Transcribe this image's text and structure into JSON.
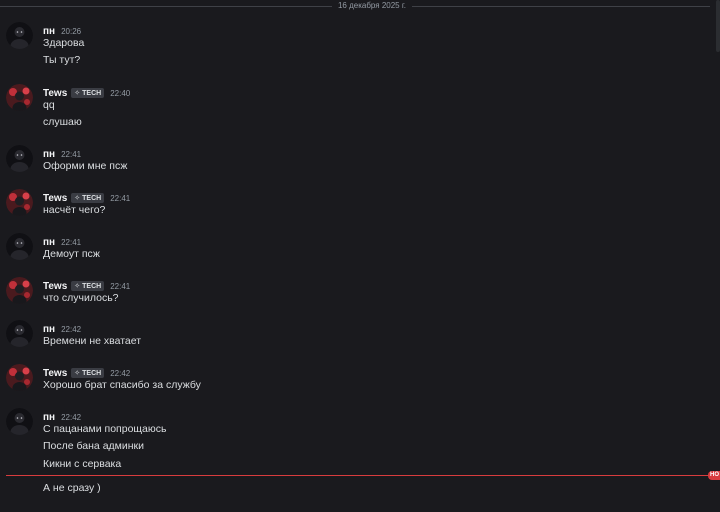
{
  "date_divider": "16 декабря 2025 г.",
  "new_badge": "НО",
  "colors": {
    "background": "#1a1a1e",
    "new_messages_line": "#d83c3e",
    "username": "#f2f3f5",
    "timestamp": "#949ba4"
  },
  "tag": {
    "icon": "diamond-sparkle-icon",
    "label": "TECH"
  },
  "messages": [
    {
      "author": "пн",
      "time": "20:26",
      "lines": [
        "Здарова",
        "Ты тут?"
      ]
    },
    {
      "author": "Tews",
      "time": "22:40",
      "lines": [
        "qq",
        "слушаю"
      ]
    },
    {
      "author": "пн",
      "time": "22:41",
      "lines": [
        "Оформи мне псж"
      ]
    },
    {
      "author": "Tews",
      "time": "22:41",
      "lines": [
        "насчёт чего?"
      ]
    },
    {
      "author": "пн",
      "time": "22:41",
      "lines": [
        "Демоут псж"
      ]
    },
    {
      "author": "Tews",
      "time": "22:41",
      "lines": [
        "что случилось?"
      ]
    },
    {
      "author": "пн",
      "time": "22:42",
      "lines": [
        "Времени не хватает"
      ]
    },
    {
      "author": "Tews",
      "time": "22:42",
      "lines": [
        "Хорошо брат спасибо за службу"
      ]
    },
    {
      "author": "пн",
      "time": "22:42",
      "lines": [
        "С пацанами попрощаюсь",
        "После бана админки",
        "Кикни с сервака"
      ]
    }
  ],
  "after_divider_line": "А не сразу )"
}
